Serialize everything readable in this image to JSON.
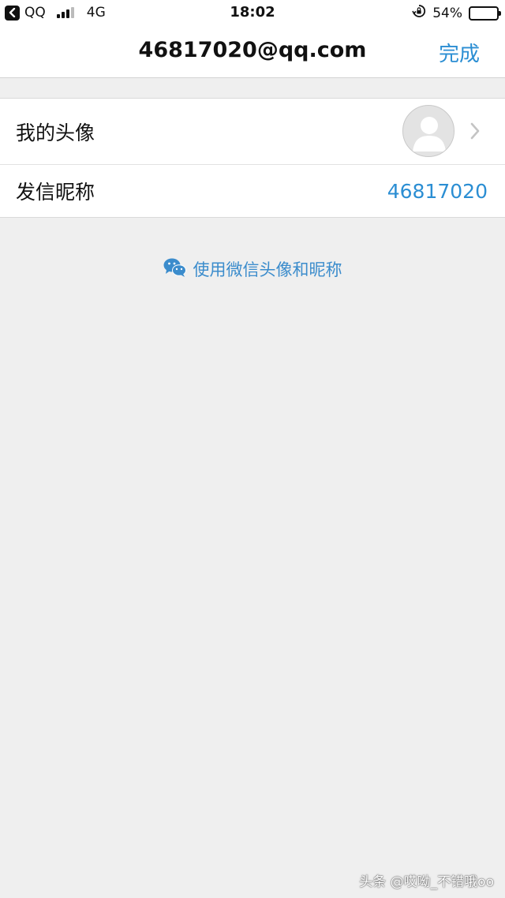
{
  "status_bar": {
    "carrier": "QQ",
    "network": "4G",
    "time": "18:02",
    "battery_percent": "54%",
    "battery_level": 0.54
  },
  "nav": {
    "title": "46817020@qq.com",
    "done_label": "完成"
  },
  "rows": [
    {
      "label": "我的头像",
      "icon": "avatar-placeholder"
    },
    {
      "label": "发信昵称",
      "value": "46817020"
    }
  ],
  "wechat": {
    "label": "使用微信头像和昵称",
    "icon": "wechat-icon",
    "color": "#3b8ccc"
  },
  "watermark": "头条 @哎呦_不错哦oo",
  "colors": {
    "accent": "#2b8ed3",
    "background": "#efefef"
  }
}
